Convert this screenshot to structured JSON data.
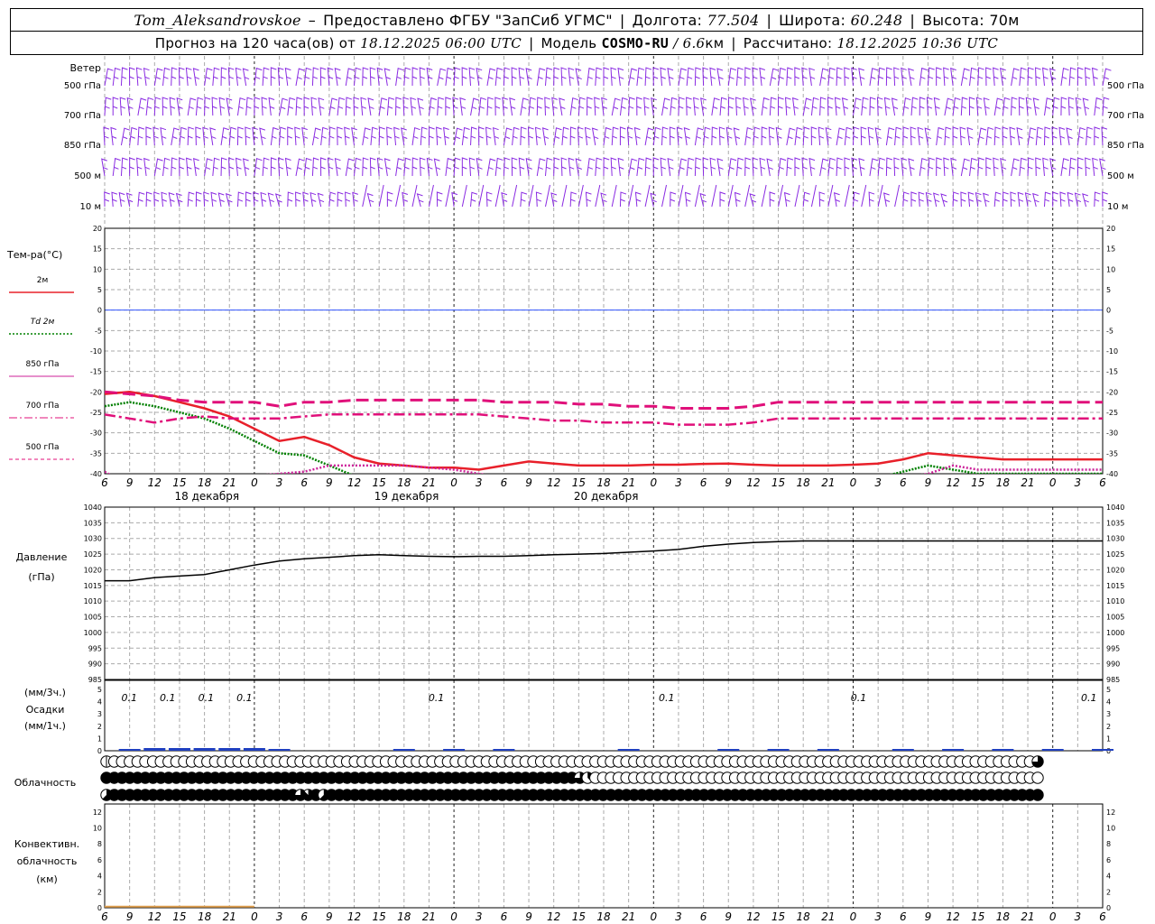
{
  "header": {
    "station": "Tom_Aleksandrovskoe",
    "dash": "–",
    "provider": "Предоставлено ФГБУ \"ЗапСиб УГМС\"",
    "lon_label": "Долгота:",
    "lon_value": "77.504",
    "lat_label": "Широта:",
    "lat_value": "60.248",
    "alt_label": "Высота:",
    "alt_value": "70м",
    "forecast_label": "Прогноз на 120 часа(ов) от",
    "forecast_time": "18.12.2025 06:00 UTC",
    "model_label": "Модель",
    "model_name": "COSMO-RU",
    "model_res": "/ 6.6",
    "model_res_unit": "км",
    "calc_label": "Рассчитано:",
    "calc_time": "18.12.2025 10:36 UTC"
  },
  "colors": {
    "wind": "#8a2be2",
    "t2m": "#e8202a",
    "td2m": "#008000",
    "t850": "#cc2299",
    "t700": "#e0107a",
    "t500": "#e0107a",
    "zero_line": "#3355ff",
    "pressure": "#000000",
    "precip": "#1f3fbf",
    "conv": "#e0a050",
    "grid": "#aaaaaa"
  },
  "chart_data": [
    {
      "type": "barbs",
      "name": "wind",
      "label": "Ветер",
      "levels": [
        "500 гПа",
        "700 гПа",
        "850 гПа",
        "500 м",
        "10  м"
      ]
    },
    {
      "type": "line",
      "name": "temperature",
      "label": "Тем-ра(°С)",
      "ylim": [
        -40,
        20
      ],
      "yticks": [
        20,
        15,
        10,
        5,
        0,
        -5,
        -10,
        -15,
        -20,
        -25,
        -30,
        -35,
        -40
      ],
      "x_hours": [
        0,
        3,
        6,
        9,
        12,
        15,
        18,
        21,
        24,
        27,
        30,
        33,
        36,
        39,
        42,
        45,
        48,
        51,
        54,
        57,
        60,
        63,
        66,
        69,
        72,
        75,
        78,
        81,
        84,
        87,
        90,
        93,
        96,
        99,
        102,
        105,
        108,
        111,
        114,
        117,
        120
      ],
      "x_tick_labels": [
        "6",
        "9",
        "12",
        "15",
        "18",
        "21",
        "0",
        "3",
        "6",
        "9",
        "12",
        "15",
        "18",
        "21",
        "0",
        "3",
        "6",
        "9",
        "12",
        "15",
        "18",
        "21",
        "0",
        "3",
        "6",
        "9",
        "12",
        "15",
        "18",
        "21",
        "0",
        "3",
        "6",
        "9",
        "12",
        "15",
        "18",
        "21",
        "0",
        "3",
        "6"
      ],
      "x_tick_labels_bottom": [
        "6",
        "9",
        "12",
        "15",
        "18",
        "21",
        "0",
        "3",
        "6",
        "9",
        "12",
        "15",
        "18",
        "21",
        "0",
        "3",
        "6",
        "9",
        "12",
        "15",
        "18",
        "21",
        "0",
        "3",
        "6",
        "9",
        "12",
        "15",
        "18",
        "21",
        "0",
        "3",
        "6",
        "9",
        "12",
        "15",
        "18",
        "21",
        "0",
        "3",
        "6"
      ],
      "day_labels": [
        "18 декабря",
        "19 декабря",
        "20 декабря"
      ],
      "legend": [
        {
          "label": "2м",
          "style": "solid"
        },
        {
          "label": "Td  2м",
          "style": "dotted"
        },
        {
          "label": "850 гПа",
          "style": "solid-thin"
        },
        {
          "label": "700 гПа",
          "style": "dashdot"
        },
        {
          "label": "500 гПа",
          "style": "dashed"
        }
      ],
      "series": [
        {
          "name": "2м",
          "values": [
            -20.5,
            -20,
            -21,
            -22.5,
            -24,
            -26,
            -29,
            -32,
            -31,
            -33,
            -36,
            -37.5,
            -38,
            -38.5,
            -38.5,
            -39,
            -38,
            -37,
            -37.5,
            -38,
            -38,
            -38,
            -37.8,
            -37.8,
            -37.6,
            -37.5,
            -37.8,
            -38,
            -38,
            -38,
            -37.8,
            -37.5,
            -36.5,
            -35,
            -35.5,
            -36,
            -36.5,
            -36.5,
            -36.5,
            -36.5,
            -36.5
          ]
        },
        {
          "name": "Td 2м",
          "values": [
            -23.5,
            -22.5,
            -23.5,
            -25,
            -26.5,
            -29,
            -32,
            -35,
            -35.5,
            -38,
            -40.5,
            -42,
            -43,
            -43,
            -43,
            -43,
            -42,
            -41,
            -41,
            -42,
            -42,
            -42,
            -42,
            -42,
            -42,
            -42,
            -42,
            -41.5,
            -41.5,
            -41.5,
            -41.5,
            -41,
            -39.5,
            -38,
            -39,
            -40,
            -40,
            -40,
            -40,
            -40,
            -40
          ]
        },
        {
          "name": "850 гПа",
          "values": [
            -39.5,
            -43,
            -42,
            -41,
            -41,
            -41,
            -40.5,
            -40,
            -39.5,
            -38,
            -38,
            -38,
            -38,
            -38.5,
            -39,
            -40,
            -41,
            -41,
            -41,
            -41,
            -41.5,
            -41.5,
            -41.5,
            -41.5,
            -41.5,
            -41.5,
            -41.5,
            -41.5,
            -41.5,
            -41.5,
            -41.5,
            -41.5,
            -41,
            -40,
            -38,
            -39,
            -39,
            -39,
            -39,
            -39,
            -39
          ]
        },
        {
          "name": "700 гПа",
          "values": [
            -25.5,
            -26.5,
            -27.5,
            -26.5,
            -26,
            -26.5,
            -26.5,
            -26.5,
            -26,
            -25.5,
            -25.5,
            -25.5,
            -25.5,
            -25.5,
            -25.5,
            -25.5,
            -26,
            -26.5,
            -27,
            -27,
            -27.5,
            -27.5,
            -27.5,
            -28,
            -28,
            -28,
            -27.5,
            -26.5,
            -26.5,
            -26.5,
            -26.5,
            -26.5,
            -26.5,
            -26.5,
            -26.5,
            -26.5,
            -26.5,
            -26.5,
            -26.5,
            -26.5,
            -26.5
          ]
        },
        {
          "name": "500 гПа",
          "values": [
            -20,
            -20.5,
            -21,
            -22,
            -22.5,
            -22.5,
            -22.5,
            -23.5,
            -22.5,
            -22.5,
            -22,
            -22,
            -22,
            -22,
            -22,
            -22,
            -22.5,
            -22.5,
            -22.5,
            -23,
            -23,
            -23.5,
            -23.5,
            -24,
            -24,
            -24,
            -23.5,
            -22.5,
            -22.5,
            -22.5,
            -22.5,
            -22.5,
            -22.5,
            -22.5,
            -22.5,
            -22.5,
            -22.5,
            -22.5,
            -22.5,
            -22.5,
            -22.5
          ]
        }
      ]
    },
    {
      "type": "line",
      "name": "pressure",
      "label_line1": "Давление",
      "label_line2": "(гПа)",
      "ylim": [
        985,
        1040
      ],
      "yticks": [
        1040,
        1035,
        1030,
        1025,
        1020,
        1015,
        1010,
        1005,
        1000,
        995,
        990,
        985
      ],
      "values": [
        1016.5,
        1016.5,
        1017.5,
        1018,
        1018.5,
        1020,
        1021.5,
        1022.8,
        1023.5,
        1024,
        1024.5,
        1024.8,
        1024.5,
        1024.3,
        1024.2,
        1024.3,
        1024.3,
        1024.5,
        1024.8,
        1025,
        1025.2,
        1025.6,
        1026,
        1026.5,
        1027.5,
        1028.2,
        1028.7,
        1029,
        1029.2,
        1029.2,
        1029.2,
        1029.2,
        1029.2,
        1029.2,
        1029.2,
        1029.2,
        1029.2,
        1029.2,
        1029.2,
        1029.2,
        1029.2
      ]
    },
    {
      "type": "bar",
      "name": "precipitation",
      "label_line1": "(мм/3ч.)",
      "label_line2": "Осадки",
      "label_line3": "(мм/1ч.)",
      "ylim": [
        0,
        5
      ],
      "yticks": [
        5,
        4,
        3,
        2,
        1,
        0
      ],
      "annotations": [
        {
          "hour": 3,
          "text": "0.1"
        },
        {
          "hour": 9,
          "text": "0.1"
        },
        {
          "hour": 15,
          "text": "0.1"
        },
        {
          "hour": 21,
          "text": "0.1"
        },
        {
          "hour": 51,
          "text": "0.1"
        },
        {
          "hour": 87,
          "text": "0.1"
        },
        {
          "hour": 117,
          "text": "0.1"
        },
        {
          "hour": 153,
          "text": "0.1"
        }
      ],
      "values_mm_per_3h": [
        0,
        0.05,
        0.1,
        0.1,
        0.1,
        0.1,
        0.1,
        0.05,
        0,
        0,
        0,
        0,
        0.02,
        0,
        0.02,
        0,
        0.02,
        0,
        0,
        0,
        0,
        0.02,
        0,
        0,
        0,
        0.02,
        0,
        0.02,
        0,
        0.02,
        0,
        0,
        0.02,
        0,
        0.02,
        0,
        0.02,
        0,
        0.02,
        0,
        0.02
      ]
    },
    {
      "type": "table",
      "name": "cloudiness",
      "label": "Облачность",
      "rows_eighths": {
        "upper": [
          0,
          0,
          0,
          0,
          0,
          0,
          0,
          0,
          0,
          0,
          0,
          0,
          0,
          0,
          0,
          0,
          0,
          0,
          0,
          0,
          0,
          0,
          0,
          0,
          0,
          0,
          0,
          0,
          0,
          0,
          0,
          0,
          0,
          0,
          0,
          0,
          0,
          0,
          0,
          0,
          0,
          0,
          0,
          0,
          0,
          0,
          0,
          0,
          0,
          0,
          0,
          0,
          0,
          0,
          0,
          0,
          0,
          0,
          0,
          0,
          0,
          0,
          0,
          0,
          0,
          0,
          0,
          0,
          0,
          0,
          0,
          0,
          0,
          0,
          0,
          0,
          0,
          0,
          0,
          0,
          0,
          0,
          0,
          0,
          0,
          0,
          0,
          0,
          0,
          0,
          0,
          0,
          0,
          0,
          0,
          0,
          0,
          0,
          0,
          0,
          0,
          0,
          0,
          0,
          0,
          0,
          0,
          0,
          0,
          0,
          0,
          0,
          0,
          0,
          0,
          0,
          0,
          0,
          0,
          0,
          6
        ],
        "middle": [
          8,
          8,
          8,
          8,
          8,
          8,
          8,
          8,
          8,
          8,
          8,
          8,
          8,
          8,
          8,
          8,
          8,
          8,
          8,
          8,
          8,
          8,
          8,
          8,
          8,
          8,
          8,
          8,
          8,
          8,
          8,
          8,
          8,
          8,
          8,
          8,
          8,
          8,
          8,
          8,
          8,
          8,
          8,
          8,
          8,
          8,
          8,
          8,
          8,
          8,
          8,
          8,
          8,
          8,
          8,
          8,
          8,
          8,
          8,
          8,
          8,
          6,
          3,
          0,
          0,
          0,
          0,
          0,
          0,
          0,
          0,
          0,
          0,
          0,
          0,
          0,
          0,
          0,
          0,
          0,
          0,
          0,
          0,
          0,
          0,
          0,
          0,
          0,
          0,
          0,
          0,
          0,
          0,
          0,
          0,
          0,
          0,
          0,
          0,
          0,
          0,
          0,
          0,
          0,
          0,
          0,
          0,
          0,
          0,
          0,
          0,
          0,
          0,
          0,
          0,
          0,
          0,
          0,
          0,
          0,
          0
        ],
        "lower": [
          5,
          8,
          8,
          8,
          8,
          8,
          8,
          8,
          8,
          8,
          8,
          8,
          8,
          8,
          8,
          8,
          8,
          8,
          8,
          8,
          8,
          8,
          8,
          8,
          8,
          6,
          7,
          8,
          5,
          8,
          8,
          8,
          8,
          8,
          8,
          8,
          8,
          8,
          8,
          8,
          8,
          8,
          8,
          8,
          8,
          8,
          8,
          8,
          8,
          8,
          8,
          8,
          8,
          8,
          8,
          8,
          8,
          8,
          8,
          8,
          8,
          8,
          8,
          8,
          8,
          8,
          8,
          8,
          8,
          8,
          8,
          8,
          8,
          8,
          8,
          8,
          8,
          8,
          8,
          8,
          8,
          8,
          8,
          8,
          8,
          8,
          8,
          8,
          8,
          8,
          8,
          8,
          8,
          8,
          8,
          8,
          8,
          8,
          8,
          8,
          8,
          8,
          8,
          8,
          8,
          8,
          8,
          8,
          8,
          8,
          8,
          8,
          8,
          8,
          8,
          8,
          8,
          8,
          8,
          8,
          8
        ]
      }
    },
    {
      "type": "area",
      "name": "convective_cloudiness",
      "label_line1": "Конвективн.",
      "label_line2": "облачность",
      "label_line3": "(км)",
      "ylim": [
        0,
        13
      ],
      "yticks": [
        12,
        10,
        8,
        6,
        4,
        2,
        0
      ],
      "values_km": [
        0.15,
        0.15,
        0.15,
        0.15,
        0.15,
        0.15,
        0.15
      ]
    }
  ]
}
